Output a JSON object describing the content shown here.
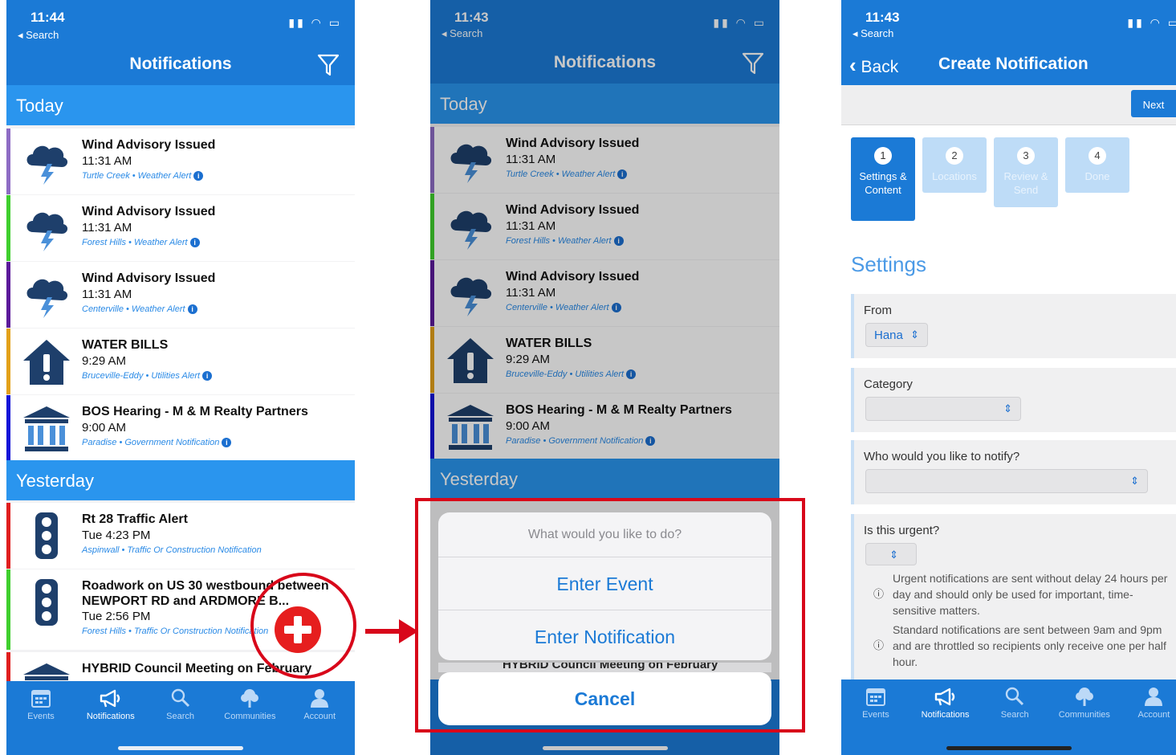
{
  "screens": {
    "list": {
      "time": "11:44",
      "back_label": "◂ Search",
      "title": "Notifications",
      "sections": {
        "today": "Today",
        "yesterday": "Yesterday"
      },
      "items": [
        {
          "title": "Wind Advisory Issued",
          "time": "11:31 AM",
          "sub": "Turtle Creek • Weather Alert",
          "icon": "storm-cloud-icon",
          "color": "#8e6cc4"
        },
        {
          "title": "Wind Advisory Issued",
          "time": "11:31 AM",
          "sub": "Forest Hills • Weather Alert",
          "icon": "storm-cloud-icon",
          "color": "#3fcf2e"
        },
        {
          "title": "Wind Advisory Issued",
          "time": "11:31 AM",
          "sub": "Centerville • Weather Alert",
          "icon": "storm-cloud-icon",
          "color": "#5b1a9a"
        },
        {
          "title": "WATER BILLS",
          "time": "9:29 AM",
          "sub": "Bruceville-Eddy • Utilities Alert",
          "icon": "house-alert-icon",
          "color": "#e3a11a"
        },
        {
          "title": "BOS Hearing - M & M Realty Partners",
          "time": "9:00 AM",
          "sub": "Paradise • Government Notification",
          "icon": "government-building-icon",
          "color": "#1414d8"
        },
        {
          "title": "Rt 28 Traffic Alert",
          "time": "Tue 4:23 PM",
          "sub": "Aspinwall • Traffic Or Construction Notification",
          "icon": "traffic-light-icon",
          "color": "#e01e1e"
        },
        {
          "title": "Roadwork on US 30 westbound between",
          "title2": "NEWPORT RD and ARDMORE B...",
          "time": "Tue 2:56 PM",
          "sub": "Forest Hills • Traffic Or Construction Notification",
          "icon": "traffic-light-icon",
          "color": "#3fcf2e"
        },
        {
          "title": "HYBRID Council Meeting on February",
          "time": "",
          "sub": "",
          "icon": "government-building-icon",
          "color": "#e01e1e"
        }
      ]
    },
    "actions": {
      "time": "11:43",
      "back_label": "◂ Search",
      "title": "Notifications",
      "prompt": "What would you like to do?",
      "options": [
        "Enter Event",
        "Enter Notification"
      ],
      "cancel": "Cancel",
      "peek_title": "HYBRID Council Meeting on February"
    },
    "create": {
      "time": "11:43",
      "back_label": "◂ Search",
      "nav_back": "Back",
      "title": "Create Notification",
      "next": "Next",
      "steps": [
        {
          "num": "1",
          "label": "Settings & Content",
          "active": true
        },
        {
          "num": "2",
          "label": "Locations",
          "active": false
        },
        {
          "num": "3",
          "label": "Review & Send",
          "active": false
        },
        {
          "num": "4",
          "label": "Done",
          "active": false
        }
      ],
      "settings_heading": "Settings",
      "from_label": "From",
      "from_value": "Hana",
      "category_label": "Category",
      "notify_label": "Who would you like to notify?",
      "urgent_label": "Is this urgent?",
      "urgent_note_1": "Urgent notifications are sent without delay 24 hours per day and should only be used for important, time-sensitive matters.",
      "urgent_note_2": "Standard notifications are sent between 9am and 9pm and are throttled so recipients only receive one per half hour."
    }
  },
  "tabs": [
    "Events",
    "Notifications",
    "Search",
    "Communities",
    "Account"
  ],
  "colors": {
    "brand_blue": "#1b7ad6",
    "section_blue": "#2a95ee",
    "highlight_red": "#d8071a"
  }
}
